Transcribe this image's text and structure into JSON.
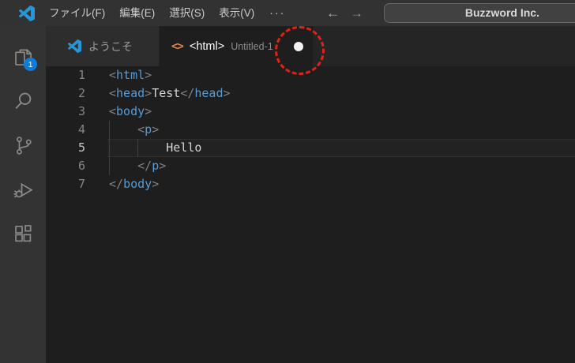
{
  "title_bar": {
    "menus": [
      "ファイル(F)",
      "編集(E)",
      "選択(S)",
      "表示(V)"
    ],
    "more_label": "···",
    "back_icon": "←",
    "forward_icon": "→",
    "search": {
      "value": "Buzzword Inc."
    }
  },
  "activity_bar": {
    "items": [
      {
        "name": "explorer",
        "icon": "files-icon",
        "badge": "1"
      },
      {
        "name": "search",
        "icon": "search-icon"
      },
      {
        "name": "source-control",
        "icon": "source-control-icon"
      },
      {
        "name": "run-debug",
        "icon": "run-debug-icon"
      },
      {
        "name": "extensions",
        "icon": "extensions-icon"
      }
    ]
  },
  "tabs": [
    {
      "label": "ようこそ",
      "icon": "vscode-logo-icon",
      "active": false
    },
    {
      "label": "<html>",
      "description": "Untitled-1",
      "icon": "html-file-icon",
      "icon_glyph": "<>",
      "dirty": true,
      "active": true
    }
  ],
  "editor": {
    "lines": [
      {
        "no": "1",
        "tokens": [
          {
            "c": "punct",
            "t": "<"
          },
          {
            "c": "tag",
            "t": "html"
          },
          {
            "c": "punct",
            "t": ">"
          }
        ]
      },
      {
        "no": "2",
        "tokens": [
          {
            "c": "punct",
            "t": "<"
          },
          {
            "c": "tag",
            "t": "head"
          },
          {
            "c": "punct",
            "t": ">"
          },
          {
            "c": "text",
            "t": "Test"
          },
          {
            "c": "punct",
            "t": "</"
          },
          {
            "c": "tag",
            "t": "head"
          },
          {
            "c": "punct",
            "t": ">"
          }
        ]
      },
      {
        "no": "3",
        "tokens": [
          {
            "c": "punct",
            "t": "<"
          },
          {
            "c": "tag",
            "t": "body"
          },
          {
            "c": "punct",
            "t": ">"
          }
        ]
      },
      {
        "no": "4",
        "tokens": [
          {
            "c": "text",
            "t": "    "
          },
          {
            "c": "punct",
            "t": "<"
          },
          {
            "c": "tag",
            "t": "p"
          },
          {
            "c": "punct",
            "t": ">"
          }
        ]
      },
      {
        "no": "5",
        "current": true,
        "tokens": [
          {
            "c": "text",
            "t": "        "
          },
          {
            "c": "text",
            "t": "Hello"
          }
        ]
      },
      {
        "no": "6",
        "tokens": [
          {
            "c": "text",
            "t": "    "
          },
          {
            "c": "punct",
            "t": "</"
          },
          {
            "c": "tag",
            "t": "p"
          },
          {
            "c": "punct",
            "t": ">"
          }
        ]
      },
      {
        "no": "7",
        "tokens": [
          {
            "c": "punct",
            "t": "</"
          },
          {
            "c": "tag",
            "t": "body"
          },
          {
            "c": "punct",
            "t": ">"
          }
        ]
      }
    ]
  },
  "annotation": {
    "shape": "dashed-circle",
    "color": "#df2318",
    "target": "dirty-indicator"
  },
  "colors": {
    "accent_badge": "#0d7dd8",
    "logo_blue": "#2596d6",
    "tag_blue": "#569cd6",
    "html_icon_orange": "#e8884a",
    "annotation_red": "#df2318"
  }
}
